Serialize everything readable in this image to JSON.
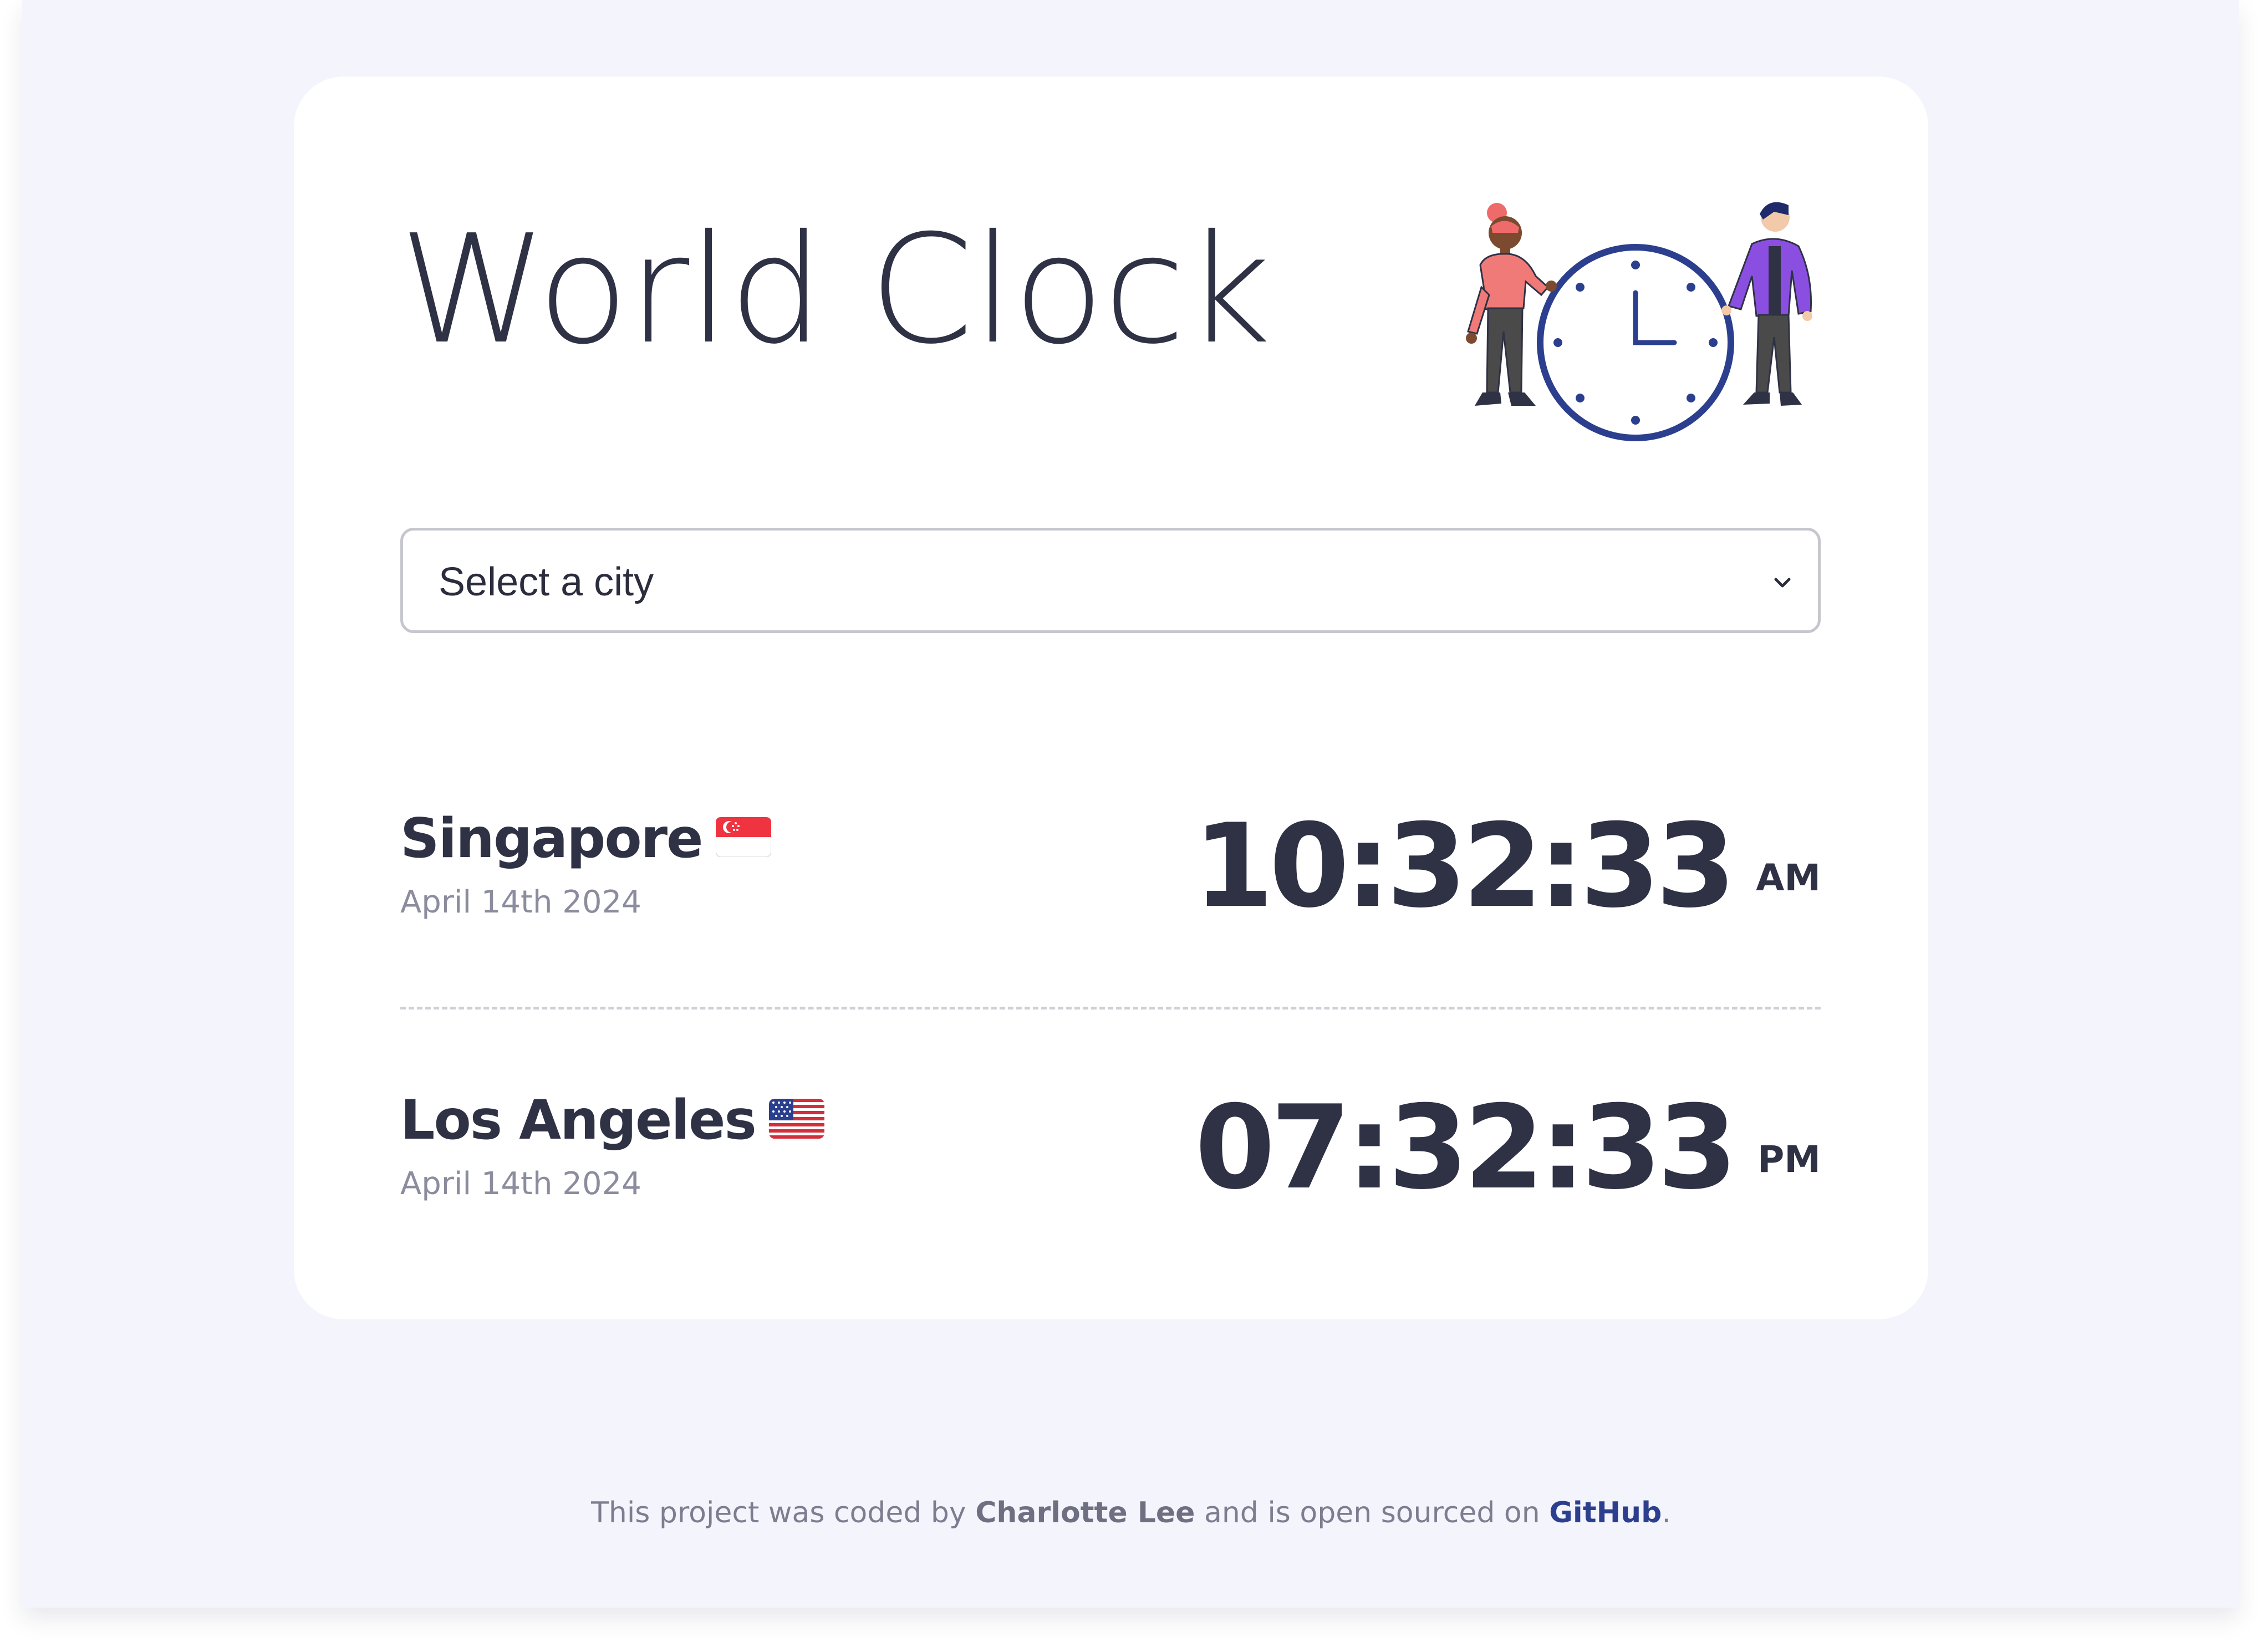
{
  "page": {
    "background": "#f3f4fc",
    "card_background": "#ffffff",
    "accent": "#2b3f8e",
    "text_color": "#2f3145",
    "muted_color": "#8b8d9e"
  },
  "header": {
    "title": "World Clock",
    "illustration": "two-people-with-clock-illustration"
  },
  "city_select": {
    "selected_value": "Select a city",
    "icon": "chevron-down-icon"
  },
  "cities": [
    {
      "name": "Singapore",
      "flag": "singapore-flag",
      "date": "April 14th 2024",
      "time": "10:32:33",
      "period": "AM"
    },
    {
      "name": "Los Angeles",
      "flag": "usa-flag",
      "date": "April 14th 2024",
      "time": "07:32:33",
      "period": "PM"
    }
  ],
  "footer": {
    "prefix": "This project was coded by",
    "author": "Charlotte Lee",
    "middle": "and is open sourced on",
    "link_label": "GitHub",
    "suffix": "."
  }
}
